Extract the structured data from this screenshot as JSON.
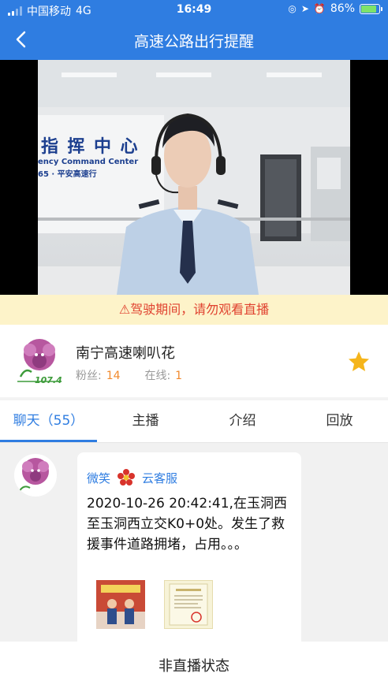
{
  "status_bar": {
    "carrier": "中国移动",
    "network": "4G",
    "time": "16:49",
    "battery": "86%",
    "battery_level": 0.86
  },
  "nav": {
    "title": "高速公路出行提醒",
    "back_icon": "chevron-left-icon"
  },
  "video": {
    "sign_title": "指 挥 中 心",
    "sign_en": "ency Command Center",
    "sign_sub": "65 · 平安高速行"
  },
  "warning": {
    "icon": "warning-icon",
    "text": "驾驶期间，请勿观看直播"
  },
  "channel": {
    "name": "南宁高速喇叭花",
    "fans_label": "粉丝:",
    "fans_count": "14",
    "online_label": "在线:",
    "online_count": "1",
    "logo_text": "107.4",
    "favorite_icon": "star-icon"
  },
  "tabs": [
    {
      "label": "聊天（55）",
      "active": true
    },
    {
      "label": "主播",
      "active": false
    },
    {
      "label": "介绍",
      "active": false
    },
    {
      "label": "回放",
      "active": false
    }
  ],
  "chat": {
    "messages": [
      {
        "sender": "微笑",
        "role": "云客服",
        "text": "2020-10-26 20:42:41,在玉洞西至玉洞西立交K0+0处。发生了救援事件道路拥堵，占用。。。"
      }
    ]
  },
  "bottom": {
    "label": "非直播状态"
  },
  "colors": {
    "primary": "#2f7de1",
    "warning_bg": "#fdf3c9",
    "warning_text": "#e0422f",
    "stat_value": "#f18a2d",
    "star": "#f5b51b"
  }
}
